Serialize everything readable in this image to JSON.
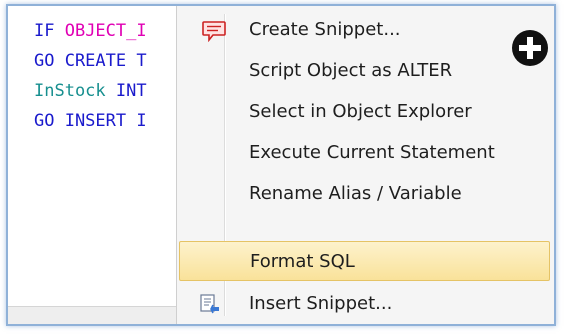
{
  "editor": {
    "lines": [
      [
        {
          "text": "IF ",
          "cls": "kw"
        },
        {
          "text": "OBJECT_I",
          "cls": "fn"
        }
      ],
      [
        {
          "text": "GO CREATE T",
          "cls": "kw"
        }
      ],
      [
        {
          "text": "InStock ",
          "cls": "ty"
        },
        {
          "text": "INT",
          "cls": "kw"
        }
      ],
      [
        {
          "text": "GO INSERT I",
          "cls": "kw"
        }
      ]
    ]
  },
  "menu": {
    "items": [
      {
        "label": "Create Snippet...",
        "icon": "snippet-icon",
        "highlighted": false
      },
      {
        "label": "Script Object as ALTER",
        "icon": "",
        "highlighted": false
      },
      {
        "label": "Select in Object Explorer",
        "icon": "",
        "highlighted": false
      },
      {
        "label": "Execute Current Statement",
        "icon": "",
        "highlighted": false
      },
      {
        "label": "Rename Alias / Variable",
        "icon": "",
        "highlighted": false
      },
      {
        "label": "Format SQL",
        "icon": "",
        "highlighted": true
      },
      {
        "label": "Insert Snippet...",
        "icon": "insert-snippet-icon",
        "highlighted": false
      }
    ]
  },
  "overlay": {
    "icon": "plus-circle-icon"
  },
  "colors": {
    "keyword": "#1a1acc",
    "function": "#e000b4",
    "type": "#178f8f",
    "highlight": "#f9e29a",
    "frame_border": "#8fb1d8"
  }
}
